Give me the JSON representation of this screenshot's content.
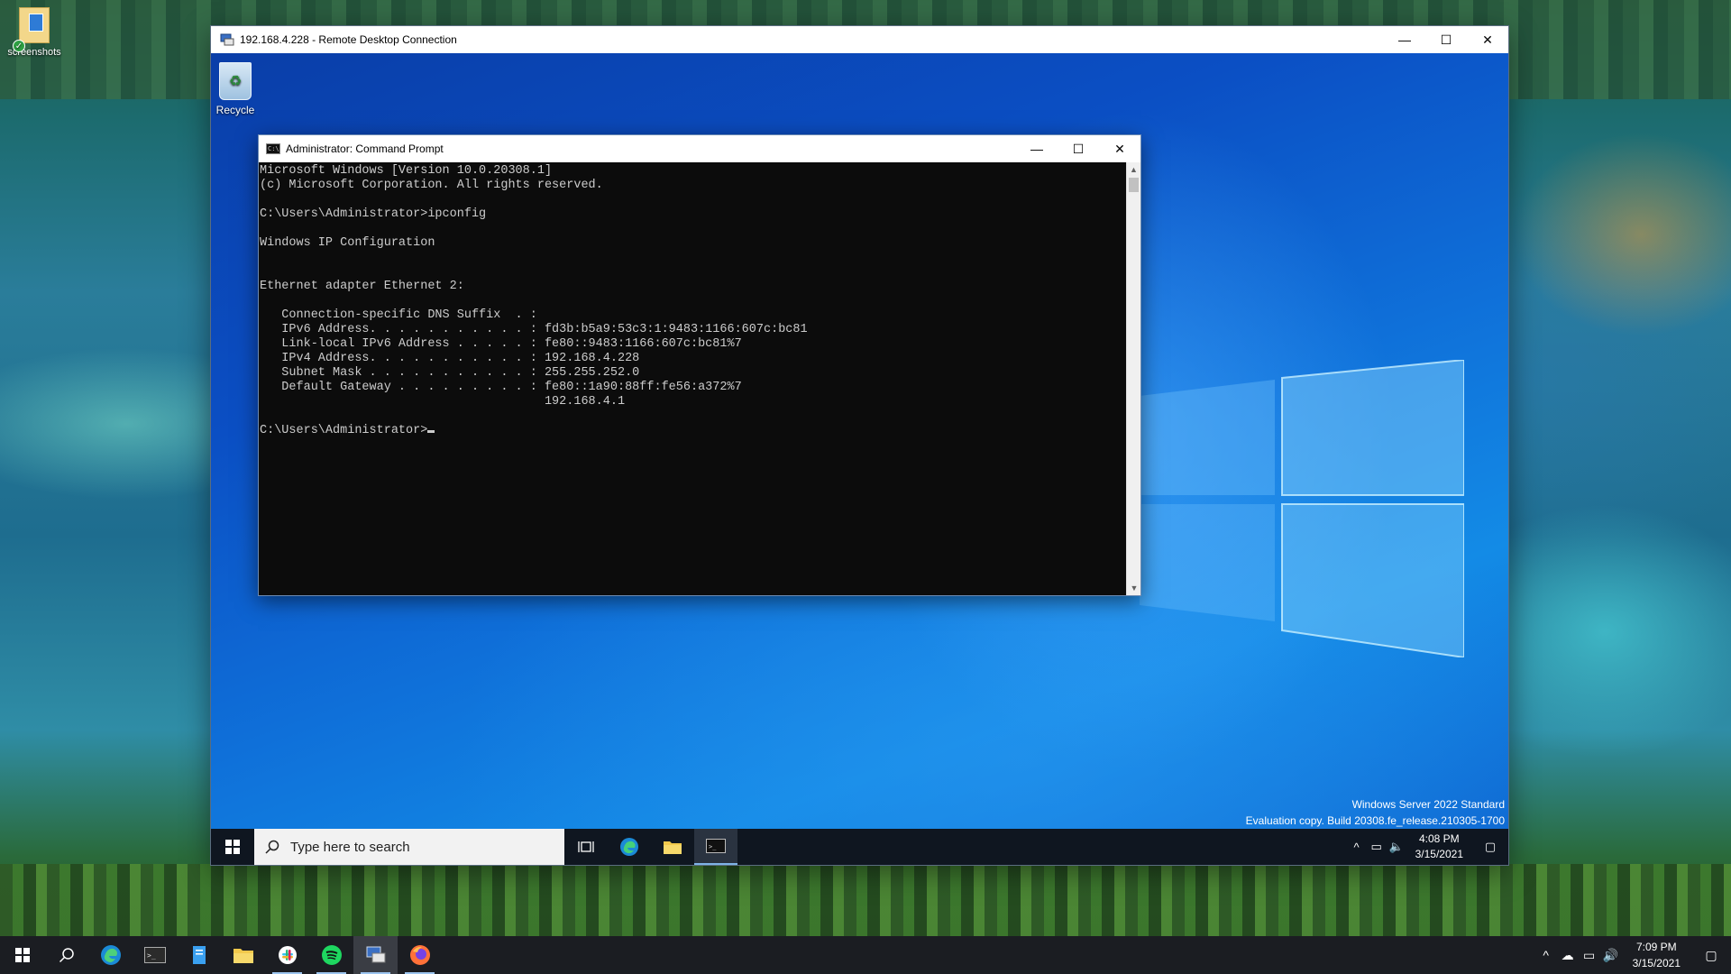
{
  "host_desktop": {
    "icons": [
      {
        "label": "screenshots",
        "icon": "folder-icon"
      }
    ]
  },
  "rdp_window": {
    "title": "192.168.4.228 - Remote Desktop Connection",
    "controls": {
      "minimize": "—",
      "maximize": "☐",
      "close": "✕"
    }
  },
  "remote_desktop": {
    "recycle_bin_label": "Recycle",
    "watermark_line1": "Windows Server 2022 Standard",
    "watermark_line2": "Evaluation copy. Build 20308.fe_release.210305-1700"
  },
  "cmd_window": {
    "title": "Administrator: Command Prompt",
    "lines": [
      "Microsoft Windows [Version 10.0.20308.1]",
      "(c) Microsoft Corporation. All rights reserved.",
      "",
      "C:\\Users\\Administrator>ipconfig",
      "",
      "Windows IP Configuration",
      "",
      "",
      "Ethernet adapter Ethernet 2:",
      "",
      "   Connection-specific DNS Suffix  . :",
      "   IPv6 Address. . . . . . . . . . . : fd3b:b5a9:53c3:1:9483:1166:607c:bc81",
      "   Link-local IPv6 Address . . . . . : fe80::9483:1166:607c:bc81%7",
      "   IPv4 Address. . . . . . . . . . . : 192.168.4.228",
      "   Subnet Mask . . . . . . . . . . . : 255.255.252.0",
      "   Default Gateway . . . . . . . . . : fe80::1a90:88ff:fe56:a372%7",
      "                                       192.168.4.1",
      ""
    ],
    "prompt": "C:\\Users\\Administrator>"
  },
  "remote_taskbar": {
    "search_placeholder": "Type here to search",
    "time": "4:08 PM",
    "date": "3/15/2021"
  },
  "host_taskbar": {
    "time": "7:09 PM",
    "date": "3/15/2021"
  },
  "colors": {
    "console_bg": "#0c0c0c",
    "console_fg": "#cccccc",
    "remote_desktop_blue": "#0f70d9",
    "taskbar": "#1b1d22"
  }
}
